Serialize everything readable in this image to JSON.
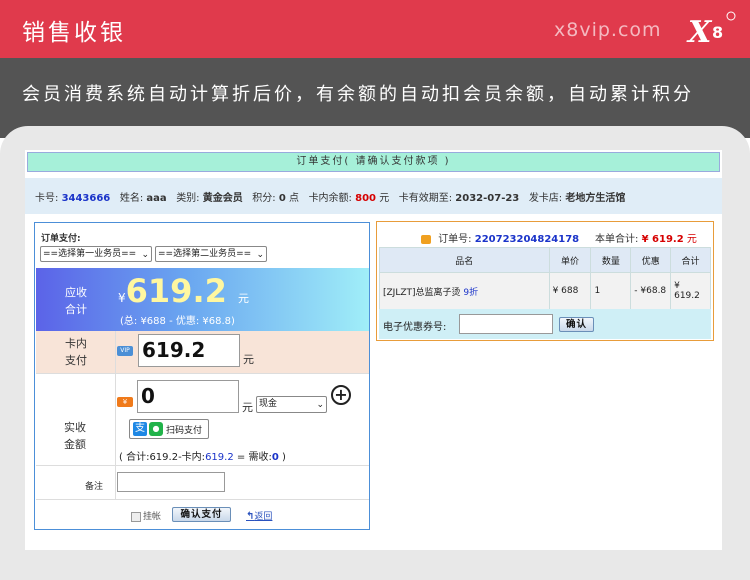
{
  "header": {
    "title": "销售收银",
    "site": "x8vip.com",
    "logo_text": "X8"
  },
  "slogan": "会员消费系统自动计算折后价，有余额的自动扣会员余额，自动累计积分",
  "order_confirm_title": "订单支付( 请确认支付款项 )",
  "member": {
    "card_label": "卡号:",
    "card_no": "3443666",
    "name_label": "姓名:",
    "name": "aaa",
    "type_label": "类别:",
    "type": "黄金会员",
    "points_label": "积分:",
    "points": "0",
    "points_unit": "点",
    "balance_label": "卡内余额:",
    "balance": "800",
    "balance_unit": "元",
    "expiry_label": "卡有效期至:",
    "expiry": "2032-07-23",
    "store_label": "发卡店:",
    "store": "老地方生活馆"
  },
  "payment": {
    "section_label": "订单支付:",
    "staff_select_1": "==选择第一业务员==",
    "staff_select_2": "==选择第二业务员==",
    "due_label_1": "应收",
    "due_label_2": "合计",
    "currency": "¥",
    "due_amount": "619.2",
    "due_unit": "元",
    "due_breakdown": "(总: ¥688 - 优惠: ¥68.8)",
    "card_label_1": "卡内",
    "card_label_2": "支付",
    "vip_badge": "VIP",
    "card_amount": "619.2",
    "card_unit": "元",
    "actual_label_1": "实收",
    "actual_label_2": "金额",
    "cash_badge": "¥",
    "actual_amount": "0",
    "actual_unit": "元",
    "method": "现金",
    "scan_label": "扫码支付",
    "calc_prefix": "( 合计:619.2-卡内:",
    "calc_card": "619.2",
    "calc_mid": " = 需收:",
    "calc_need": "0",
    "calc_suffix": " )",
    "remark_label": "备注",
    "hold_label": "挂帐",
    "confirm_button": "确认支付",
    "back_link": "返回"
  },
  "order": {
    "order_label": "订单号:",
    "order_no": "220723204824178",
    "total_label": "本单合计:",
    "total": "¥ 619.2",
    "total_unit": "元",
    "columns": [
      "品名",
      "单价",
      "数量",
      "优惠",
      "合计"
    ],
    "rows": [
      {
        "name": "[ZJLZT]总监离子烫",
        "discount_tag": "9折",
        "price": "¥ 688",
        "qty": "1",
        "discount": "- ¥68.8",
        "total_symbol": "¥",
        "total": "619.2"
      }
    ],
    "coupon_label": "电子优惠券号:",
    "coupon_button": "确认"
  },
  "colors": {
    "brand_red": "#e03a4c",
    "accent_blue": "#4c8fd8",
    "order_border": "#e89c3a"
  }
}
